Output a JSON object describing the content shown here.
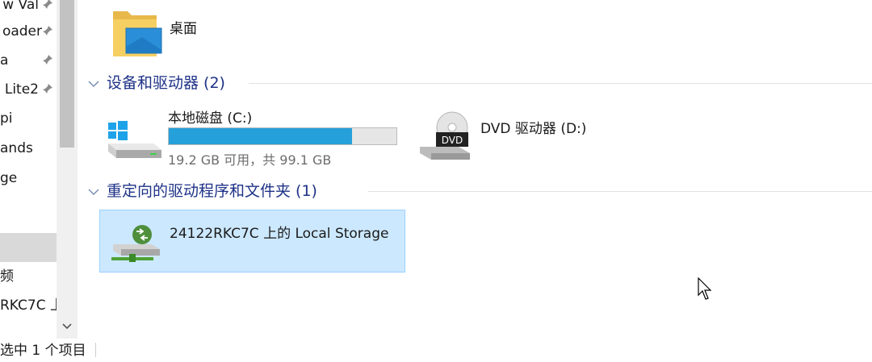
{
  "nav": {
    "items": [
      {
        "label": "w Val",
        "pinned": true
      },
      {
        "label": "oader",
        "pinned": true
      },
      {
        "label": "a",
        "pinned": true
      },
      {
        "label": "Lite2",
        "pinned": true
      },
      {
        "label": "pi",
        "pinned": false
      },
      {
        "label": "ands",
        "pinned": false
      },
      {
        "label": "ge",
        "pinned": false
      },
      {
        "label": "",
        "pinned": false
      },
      {
        "label": "",
        "pinned": false,
        "selected": true
      },
      {
        "label": "频",
        "pinned": false
      },
      {
        "label": "RKC7C 上",
        "pinned": false
      }
    ]
  },
  "status": {
    "text": "选中 1 个项目"
  },
  "folders": {
    "desktop": {
      "label": "桌面",
      "icon": "desktop-folder-icon"
    }
  },
  "groups": {
    "devices": {
      "title": "设备和驱动器 (2)"
    },
    "redirected": {
      "title": "重定向的驱动程序和文件夹 (1)"
    }
  },
  "drives": {
    "c": {
      "label": "本地磁盘 (C:)",
      "free_text": "19.2 GB 可用，共 99.1 GB",
      "used_fraction": 0.806,
      "icon": "windows-drive-icon"
    },
    "d": {
      "label": "DVD 驱动器 (D:)",
      "icon_text": "DVD",
      "icon": "dvd-drive-icon"
    }
  },
  "redirected_items": {
    "local_storage": {
      "label": "24122RKC7C 上的 Local Storage",
      "icon": "network-drive-icon"
    }
  },
  "colors": {
    "accent": "#26a0da",
    "group_header": "#1e3287",
    "selection_bg": "#cce8ff",
    "selection_border": "#99d1ff"
  }
}
